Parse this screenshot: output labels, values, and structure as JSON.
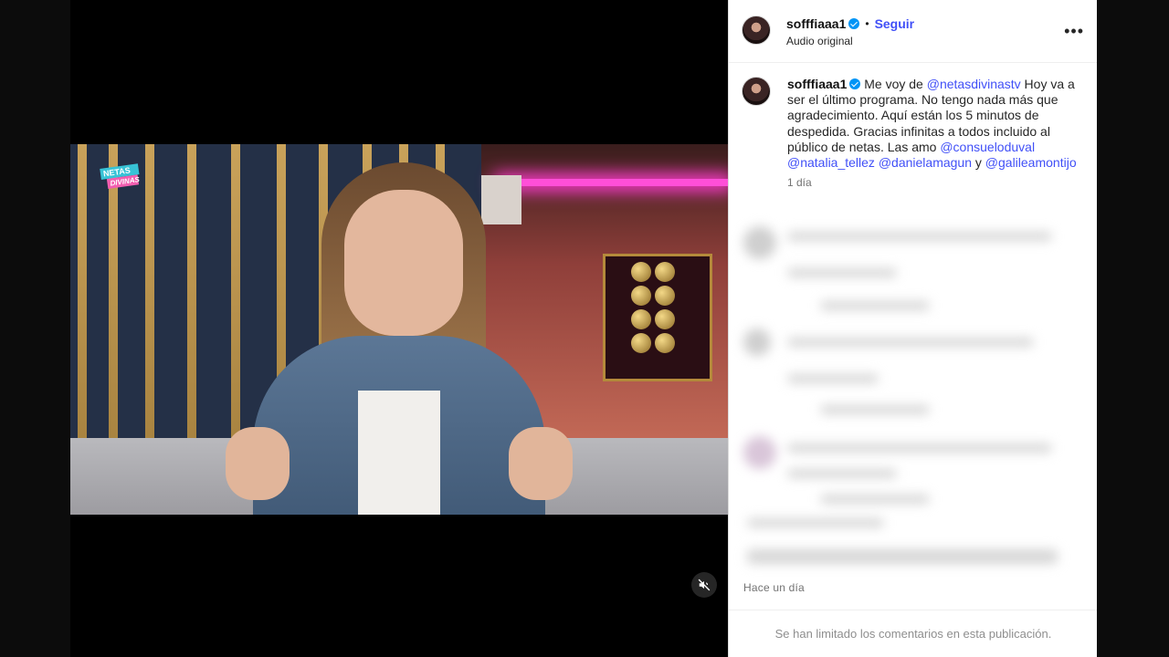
{
  "post": {
    "username": "sofffiaaa1",
    "follow_label": "Seguir",
    "separator": "•",
    "audio_label": "Audio original",
    "more_label": "•••"
  },
  "caption": {
    "username": "sofffiaaa1",
    "text_1": "Me voy de ",
    "mention_1": "@netasdivinastv",
    "text_2": " Hoy va a ser el último programa. No tengo nada más que agradecimiento. Aquí están los 5 minutos de despedida. Gracias infinitas a todos incluido al público de netas. Las amo ",
    "mention_2": "@consueloduval",
    "mention_3": "@natalia_tellez",
    "mention_4": "@danielamagun",
    "text_3": " y ",
    "mention_5": "@galileamontijo",
    "time": "1 día"
  },
  "video": {
    "logo_line1": "NETAS",
    "logo_line2": "DIVINAS",
    "mute_icon": "speaker-muted-icon"
  },
  "timestamp": "Hace un día",
  "footer": "Se han limitado los comentarios en esta publicación."
}
